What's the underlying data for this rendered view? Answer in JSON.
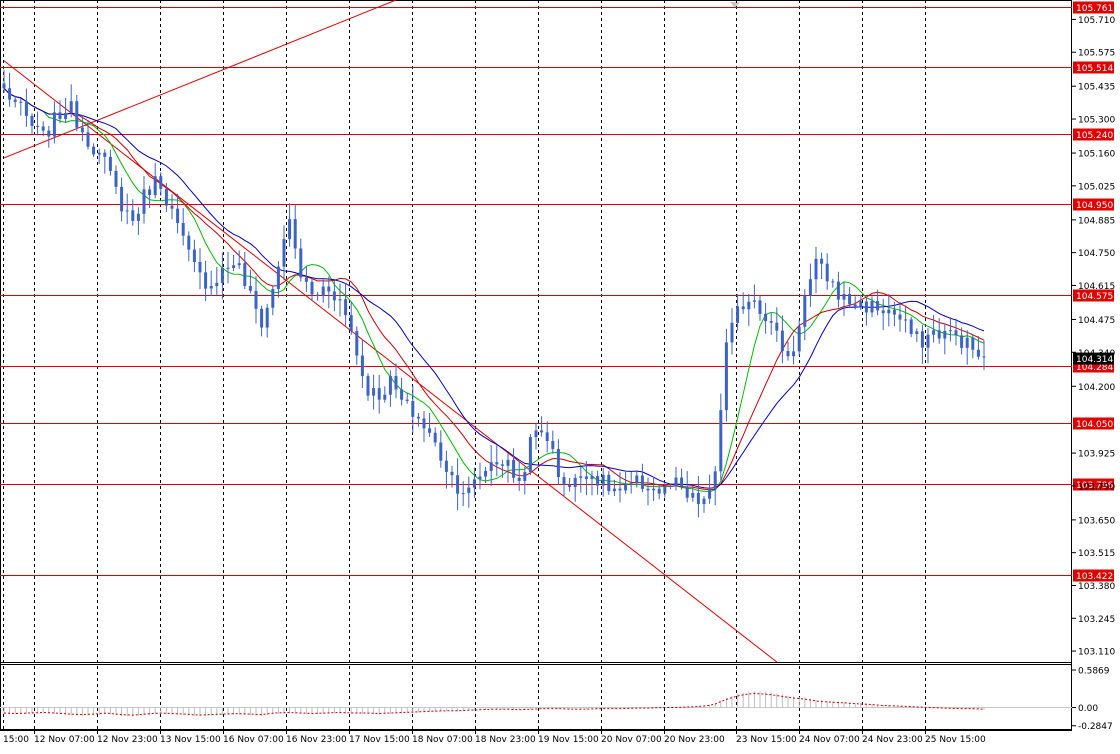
{
  "chart_data": {
    "type": "candlestick",
    "symbol_timeframe": "H1",
    "price_axis": {
      "ylim": [
        103.065,
        105.79
      ],
      "ticks": [
        "105.710",
        "105.575",
        "105.435",
        "105.300",
        "105.160",
        "105.025",
        "104.885",
        "104.750",
        "104.615",
        "104.475",
        "104.340",
        "104.200",
        "103.925",
        "103.790",
        "103.650",
        "103.515",
        "103.380",
        "103.245",
        "103.110"
      ],
      "current_price": "104.314"
    },
    "levels": [
      "105.761",
      "105.514",
      "105.240",
      "104.950",
      "104.575",
      "104.284",
      "104.050",
      "103.796",
      "103.422"
    ],
    "x_labels": [
      "12 Nov 07:00",
      "12 Nov 23:00",
      "13 Nov 15:00",
      "16 Nov 07:00",
      "16 Nov 23:00",
      "17 Nov 15:00",
      "18 Nov 07:00",
      "18 Nov 23:00",
      "19 Nov 15:00",
      "20 Nov 07:00",
      "20 Nov 23:00",
      "23 Nov 15:00",
      "24 Nov 07:00",
      "24 Nov 23:00",
      "25 Nov 15:00"
    ],
    "x_start_label": "15:00",
    "trendlines": [
      {
        "from": {
          "bar": 0,
          "price": 105.14
        },
        "to": {
          "bar": 70,
          "price": 105.79
        }
      },
      {
        "from": {
          "bar": 0,
          "price": 105.54
        },
        "to": {
          "bar": 138,
          "price": 103.065
        }
      }
    ],
    "close_series": [
      105.42,
      105.36,
      105.28,
      105.22,
      105.3,
      105.36,
      105.26,
      105.18,
      105.1,
      104.96,
      104.88,
      105.0,
      105.06,
      104.92,
      104.78,
      104.66,
      104.62,
      104.68,
      104.72,
      104.58,
      104.46,
      104.62,
      104.9,
      104.66,
      104.56,
      104.62,
      104.56,
      104.42,
      104.2,
      104.16,
      104.22,
      104.12,
      104.08,
      104.0,
      103.9,
      103.8,
      103.76,
      103.84,
      103.9,
      103.88,
      103.8,
      104.0,
      104.02,
      103.84,
      103.78,
      103.86,
      103.82,
      103.78,
      103.76,
      103.8,
      103.79,
      103.76,
      103.8,
      103.74,
      103.72,
      103.76,
      104.36,
      104.52,
      104.58,
      104.5,
      104.4,
      104.3,
      104.55,
      104.7,
      104.64,
      104.56,
      104.54,
      104.53,
      104.52,
      104.5,
      104.44,
      104.38,
      104.42,
      104.42,
      104.4,
      104.36,
      104.3
    ],
    "ma_periods": {
      "green": 8,
      "red": 14,
      "blue": 21
    },
    "indicator": {
      "ticks": [
        "0.5869",
        "0.00",
        "-0.2847"
      ],
      "ylim": [
        -0.32,
        0.65
      ],
      "series": [
        -0.1,
        -0.11,
        -0.1,
        -0.09,
        -0.1,
        -0.12,
        -0.13,
        -0.12,
        -0.1,
        -0.13,
        -0.14,
        -0.12,
        -0.1,
        -0.11,
        -0.12,
        -0.14,
        -0.13,
        -0.12,
        -0.11,
        -0.12,
        -0.13,
        -0.1,
        -0.09,
        -0.1,
        -0.11,
        -0.1,
        -0.09,
        -0.1,
        -0.1,
        -0.11,
        -0.1,
        -0.09,
        -0.08,
        -0.07,
        -0.06,
        -0.06,
        -0.05,
        -0.04,
        -0.03,
        -0.03,
        -0.04,
        -0.03,
        -0.02,
        -0.02,
        -0.03,
        -0.03,
        -0.02,
        -0.02,
        -0.02,
        -0.01,
        -0.01,
        0.0,
        0.0,
        0.01,
        0.02,
        0.05,
        0.15,
        0.22,
        0.26,
        0.25,
        0.22,
        0.18,
        0.16,
        0.12,
        0.1,
        0.09,
        0.07,
        0.06,
        0.04,
        0.03,
        0.02,
        0.01,
        0.0,
        -0.01,
        -0.02,
        -0.02,
        -0.03
      ]
    }
  },
  "colors": {
    "candle": "#3c63c4",
    "level": "#e00000",
    "level_label_bg": "#e00000",
    "ma_green": "#00bb00",
    "ma_red": "#cc0000",
    "ma_blue": "#0000cc",
    "grid": "#000000",
    "current_price_bg": "#000000"
  }
}
